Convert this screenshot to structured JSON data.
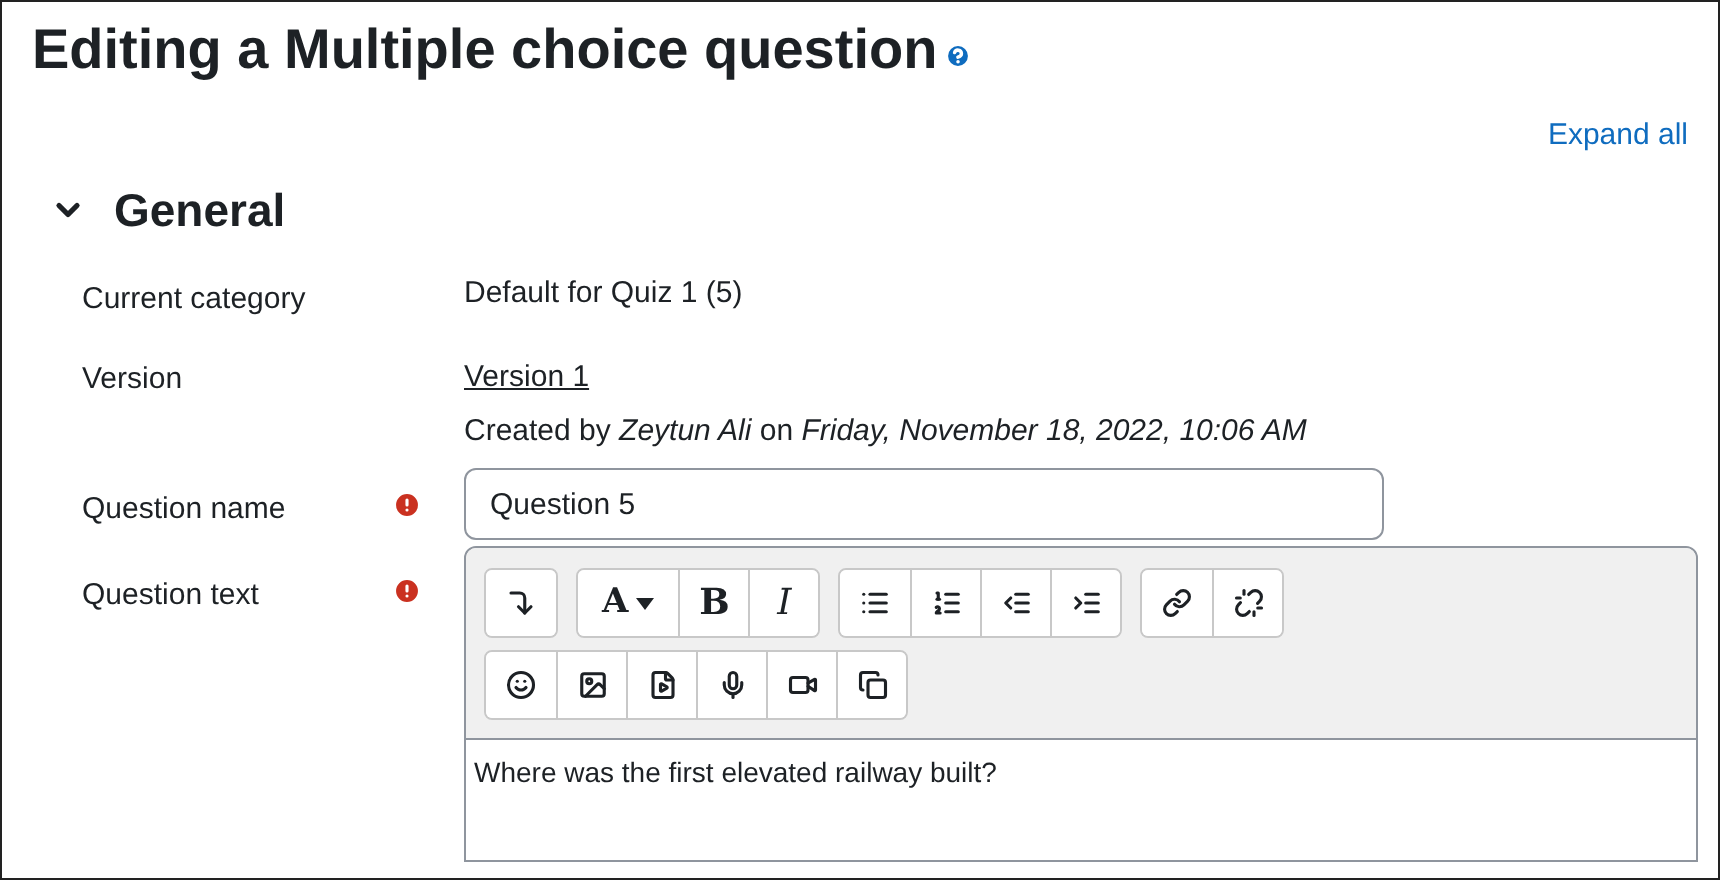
{
  "page": {
    "title": "Editing a Multiple choice question",
    "expand_all": "Expand all"
  },
  "section": {
    "title": "General",
    "expanded": true
  },
  "fields": [
    {
      "kind": "static",
      "label": "Current category",
      "required": false,
      "value": "Default for Quiz 1 (5)"
    },
    {
      "kind": "version",
      "label": "Version",
      "required": false,
      "link": "Version 1",
      "note": "Created by *Zeytun Ali* on *Friday, November 18, 2022, 10:06 AM*"
    },
    {
      "kind": "input",
      "label": "Question name",
      "required": true,
      "value": "Question 5"
    },
    {
      "kind": "editor",
      "label": "Question text",
      "required": true,
      "value": "Where was the first elevated railway built?"
    }
  ],
  "toolbar": [
    [
      [
        {
          "kind": "collapse"
        }
      ],
      [
        {
          "kind": "font",
          "label": "A"
        },
        {
          "kind": "bold",
          "label": "B"
        },
        {
          "kind": "italic",
          "label": "I"
        }
      ],
      [
        {
          "kind": "bullets"
        },
        {
          "kind": "numbers"
        },
        {
          "kind": "outdent"
        },
        {
          "kind": "indent"
        }
      ],
      [
        {
          "kind": "link"
        },
        {
          "kind": "unlink"
        }
      ]
    ],
    [
      [
        {
          "kind": "emoji"
        },
        {
          "kind": "image"
        },
        {
          "kind": "media"
        },
        {
          "kind": "mic"
        },
        {
          "kind": "video"
        },
        {
          "kind": "copy"
        }
      ]
    ]
  ]
}
